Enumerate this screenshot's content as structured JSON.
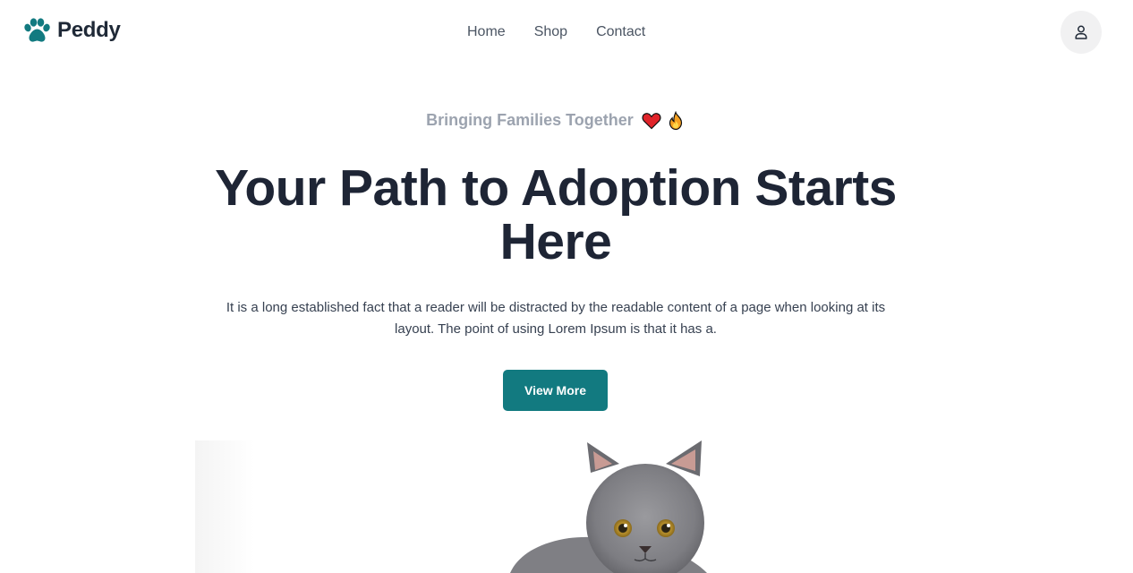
{
  "brand": {
    "name": "Peddy",
    "icon": "paw-icon",
    "color": "#127a80"
  },
  "nav": {
    "items": [
      {
        "label": "Home"
      },
      {
        "label": "Shop"
      },
      {
        "label": "Contact"
      }
    ]
  },
  "header": {
    "user_icon": "user-icon"
  },
  "hero": {
    "eyebrow": "Bringing Families Together",
    "eyebrow_emojis": [
      "heart-icon",
      "fire-icon"
    ],
    "title": "Your Path to Adoption Starts Here",
    "description": "It is a long established fact that a reader will be distracted by the readable content of a page when looking at its layout. The point of using Lorem Ipsum is that it has a.",
    "cta_label": "View More",
    "image": "cat-photo"
  },
  "colors": {
    "accent": "#127a80",
    "heading": "#1e2535",
    "eyebrow": "#9ca3af",
    "body_text": "#374151"
  }
}
